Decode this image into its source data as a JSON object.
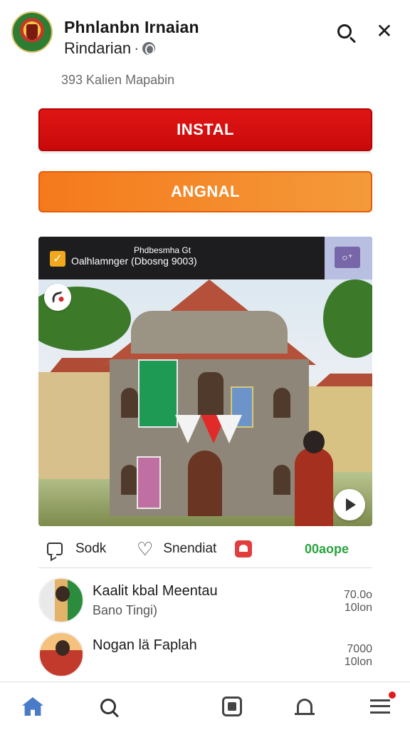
{
  "header": {
    "title": "Phnlanbn Irnaian",
    "subtitle": "Rindarian",
    "separator": "·",
    "members": "393 Kalien Mapabin"
  },
  "buttons": {
    "install": "INSTAL",
    "secondary": "ANGNAL"
  },
  "media": {
    "bar_top": "Phdbesmha Gt",
    "bar_text": "Oalhlamnger (Dbosng 9003)",
    "share_label": "○⁺"
  },
  "actions": {
    "comment_label": "Sodk",
    "like_label": "Snendiat",
    "status_label": "00aope"
  },
  "list": [
    {
      "name": "Kaalit kbal Meentau",
      "sub": "Bano Tingi)",
      "meta_top": "70.0o",
      "meta_bottom": "10lon"
    },
    {
      "name": "Nogan lä Faplah",
      "sub": "",
      "meta_top": "7000",
      "meta_bottom": "10lon"
    }
  ],
  "nav": {
    "items": [
      "home-icon",
      "search-icon",
      "feed-icon",
      "bell-icon",
      "menu-icon"
    ]
  },
  "colors": {
    "install_red": "#d51010",
    "secondary_orange": "#f5851f",
    "status_green": "#2ba33e",
    "home_blue": "#4a7bc8",
    "badge_red": "#e21b1b"
  }
}
